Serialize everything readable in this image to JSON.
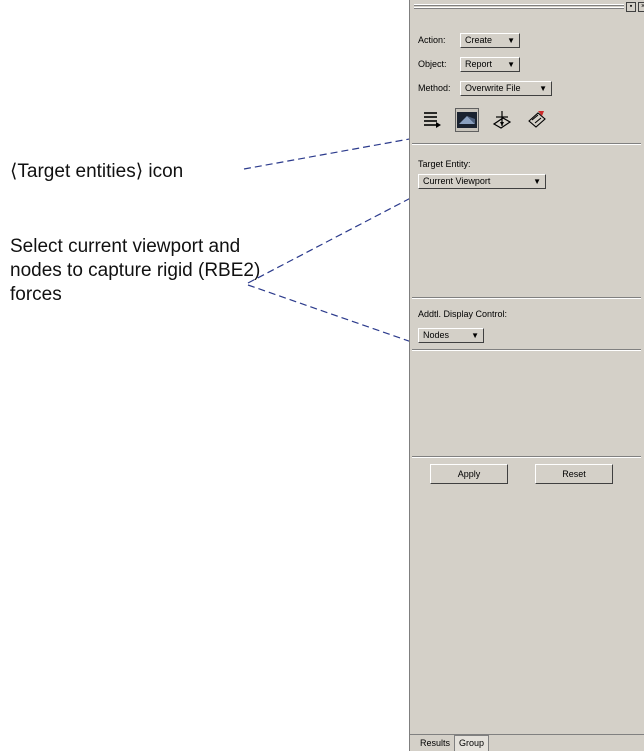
{
  "annotations": {
    "target_icon": "⟨Target entities⟩ icon",
    "select_note": "Select current viewport and nodes to capture rigid (RBE2) forces"
  },
  "panel": {
    "action": {
      "label": "Action:",
      "value": "Create"
    },
    "object": {
      "label": "Object:",
      "value": "Report"
    },
    "method": {
      "label": "Method:",
      "value": "Overwrite File"
    },
    "toolbar_icons": [
      "report-list-icon",
      "target-entities-icon",
      "display-options-icon",
      "output-file-icon"
    ],
    "target_entity": {
      "label": "Target Entity:",
      "value": "Current Viewport"
    },
    "display_control": {
      "label": "Addtl. Display Control:",
      "value": "Nodes"
    },
    "apply": "Apply",
    "reset": "Reset",
    "tabs": [
      "Results",
      "Group"
    ]
  },
  "colors": {
    "panel_bg": "#d4d0c8",
    "leader": "#2b3a8c"
  }
}
